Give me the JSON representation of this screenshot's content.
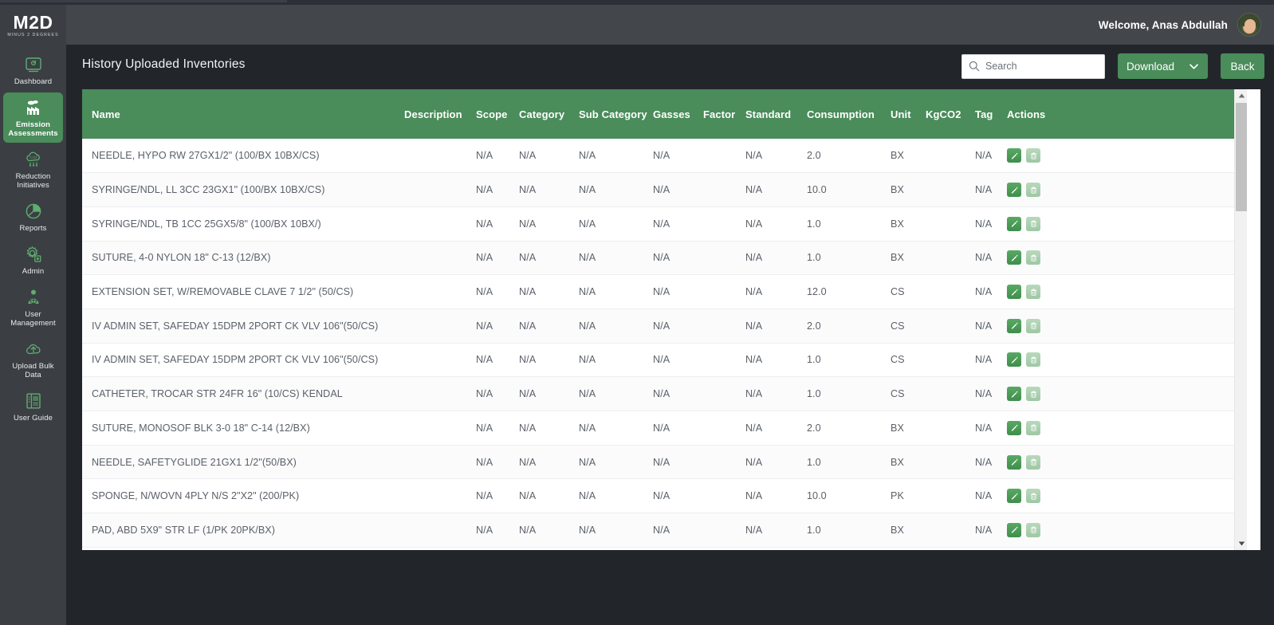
{
  "brand": {
    "name": "M2D",
    "tagline": "MINUS 2 DEGREES"
  },
  "sidebar": {
    "items": [
      {
        "label": "Dashboard",
        "icon": "dashboard-icon",
        "active": false
      },
      {
        "label": "Emission Assessments",
        "icon": "factory-icon",
        "active": true
      },
      {
        "label": "Reduction Initiatives",
        "icon": "co2-cloud-icon",
        "active": false
      },
      {
        "label": "Reports",
        "icon": "pie-chart-icon",
        "active": false
      },
      {
        "label": "Admin",
        "icon": "gear-icon",
        "active": false
      },
      {
        "label": "User Management",
        "icon": "user-icon",
        "active": false
      },
      {
        "label": "Upload Bulk Data",
        "icon": "cloud-upload-icon",
        "active": false
      },
      {
        "label": "User Guide",
        "icon": "book-icon",
        "active": false
      }
    ]
  },
  "header": {
    "welcome": "Welcome, Anas Abdullah",
    "avatar": "user-avatar"
  },
  "page": {
    "title": "History Uploaded Inventories",
    "search": {
      "placeholder": "Search",
      "value": ""
    },
    "download_label": "Download",
    "back_label": "Back"
  },
  "table": {
    "columns": [
      "Name",
      "Description",
      "Scope",
      "Category",
      "Sub Category",
      "Gasses",
      "Factor",
      "Standard",
      "Consumption",
      "Unit",
      "KgCO2",
      "Tag",
      "Actions"
    ],
    "rows": [
      {
        "name": "NEEDLE, HYPO RW 27GX1/2\" (100/BX 10BX/CS)",
        "description": "",
        "scope": "N/A",
        "category": "N/A",
        "sub_category": "N/A",
        "gasses": "N/A",
        "factor": "",
        "standard": "N/A",
        "consumption": "2.0",
        "unit": "BX",
        "kgco2": "",
        "tag": "N/A"
      },
      {
        "name": "SYRINGE/NDL, LL 3CC 23GX1\" (100/BX 10BX/CS)",
        "description": "",
        "scope": "N/A",
        "category": "N/A",
        "sub_category": "N/A",
        "gasses": "N/A",
        "factor": "",
        "standard": "N/A",
        "consumption": "10.0",
        "unit": "BX",
        "kgco2": "",
        "tag": "N/A"
      },
      {
        "name": "SYRINGE/NDL, TB 1CC 25GX5/8\" (100/BX 10BX/)",
        "description": "",
        "scope": "N/A",
        "category": "N/A",
        "sub_category": "N/A",
        "gasses": "N/A",
        "factor": "",
        "standard": "N/A",
        "consumption": "1.0",
        "unit": "BX",
        "kgco2": "",
        "tag": "N/A"
      },
      {
        "name": "SUTURE, 4-0 NYLON 18\" C-13 (12/BX)",
        "description": "",
        "scope": "N/A",
        "category": "N/A",
        "sub_category": "N/A",
        "gasses": "N/A",
        "factor": "",
        "standard": "N/A",
        "consumption": "1.0",
        "unit": "BX",
        "kgco2": "",
        "tag": "N/A"
      },
      {
        "name": "EXTENSION SET, W/REMOVABLE CLAVE 7 1/2\" (50/CS)",
        "description": "",
        "scope": "N/A",
        "category": "N/A",
        "sub_category": "N/A",
        "gasses": "N/A",
        "factor": "",
        "standard": "N/A",
        "consumption": "12.0",
        "unit": "CS",
        "kgco2": "",
        "tag": "N/A"
      },
      {
        "name": "IV ADMIN SET, SAFEDAY 15DPM 2PORT CK VLV 106\"(50/CS)",
        "description": "",
        "scope": "N/A",
        "category": "N/A",
        "sub_category": "N/A",
        "gasses": "N/A",
        "factor": "",
        "standard": "N/A",
        "consumption": "2.0",
        "unit": "CS",
        "kgco2": "",
        "tag": "N/A"
      },
      {
        "name": "IV ADMIN SET, SAFEDAY 15DPM 2PORT CK VLV 106\"(50/CS)",
        "description": "",
        "scope": "N/A",
        "category": "N/A",
        "sub_category": "N/A",
        "gasses": "N/A",
        "factor": "",
        "standard": "N/A",
        "consumption": "1.0",
        "unit": "CS",
        "kgco2": "",
        "tag": "N/A"
      },
      {
        "name": "CATHETER, TROCAR STR 24FR 16\" (10/CS) KENDAL",
        "description": "",
        "scope": "N/A",
        "category": "N/A",
        "sub_category": "N/A",
        "gasses": "N/A",
        "factor": "",
        "standard": "N/A",
        "consumption": "1.0",
        "unit": "CS",
        "kgco2": "",
        "tag": "N/A"
      },
      {
        "name": "SUTURE, MONOSOF BLK 3-0 18\" C-14 (12/BX)",
        "description": "",
        "scope": "N/A",
        "category": "N/A",
        "sub_category": "N/A",
        "gasses": "N/A",
        "factor": "",
        "standard": "N/A",
        "consumption": "2.0",
        "unit": "BX",
        "kgco2": "",
        "tag": "N/A"
      },
      {
        "name": "NEEDLE, SAFETYGLIDE 21GX1 1/2\"(50/BX)",
        "description": "",
        "scope": "N/A",
        "category": "N/A",
        "sub_category": "N/A",
        "gasses": "N/A",
        "factor": "",
        "standard": "N/A",
        "consumption": "1.0",
        "unit": "BX",
        "kgco2": "",
        "tag": "N/A"
      },
      {
        "name": "SPONGE, N/WOVN 4PLY N/S 2\"X2\" (200/PK)",
        "description": "",
        "scope": "N/A",
        "category": "N/A",
        "sub_category": "N/A",
        "gasses": "N/A",
        "factor": "",
        "standard": "N/A",
        "consumption": "10.0",
        "unit": "PK",
        "kgco2": "",
        "tag": "N/A"
      },
      {
        "name": "PAD, ABD 5X9\" STR LF (1/PK 20PK/BX)",
        "description": "",
        "scope": "N/A",
        "category": "N/A",
        "sub_category": "N/A",
        "gasses": "N/A",
        "factor": "",
        "standard": "N/A",
        "consumption": "1.0",
        "unit": "BX",
        "kgco2": "",
        "tag": "N/A"
      }
    ],
    "row_actions": {
      "edit": "edit-row",
      "delete": "delete-row"
    }
  },
  "colors": {
    "brand_green": "#4a8c5a",
    "sidebar_bg": "#3b3f44",
    "header_bg": "#43474c",
    "page_bg": "#22262b"
  }
}
